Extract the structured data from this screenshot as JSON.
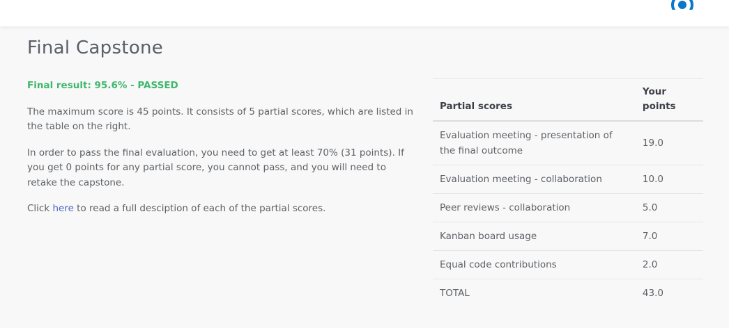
{
  "header": {
    "user_icon": "user-circle-icon",
    "accent": "#0a77c9"
  },
  "page": {
    "title": "Final Capstone"
  },
  "summary": {
    "result_text": "Final result: 95.6% - PASSED",
    "result_color": "#3fb86c",
    "paragraph1": "The maximum score is 45 points. It consists of 5 partial scores, which are listed in the table on the right.",
    "paragraph2": "In order to pass the final evaluation, you need to get at least 70% (31 points). If you get 0 points for any partial score, you cannot pass, and you will need to retake the capstone.",
    "click_prefix": "Click ",
    "link_text": "here",
    "click_suffix": " to read a full desciption of each of the partial scores."
  },
  "table": {
    "headers": [
      "Partial scores",
      "Your points"
    ],
    "rows": [
      {
        "name": "Evaluation meeting - presentation of the final outcome",
        "points": "19.0"
      },
      {
        "name": "Evaluation meeting - collaboration",
        "points": "10.0"
      },
      {
        "name": "Peer reviews - collaboration",
        "points": "5.0"
      },
      {
        "name": "Kanban board usage",
        "points": "7.0"
      },
      {
        "name": "Equal code contributions",
        "points": "2.0"
      },
      {
        "name": "TOTAL",
        "points": "43.0"
      }
    ]
  }
}
